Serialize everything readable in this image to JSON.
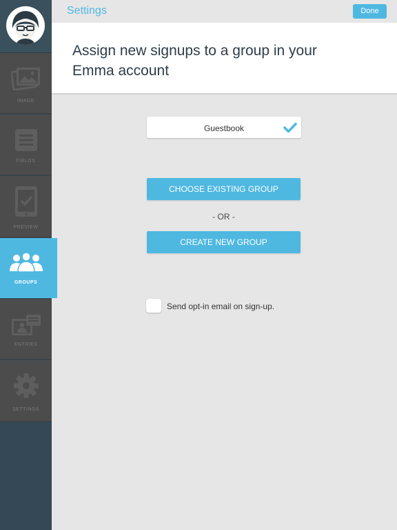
{
  "topbar": {
    "title": "Settings",
    "done_label": "Done"
  },
  "header": {
    "heading": "Assign new signups to a group in your Emma account"
  },
  "sidebar": {
    "items": [
      {
        "label": "IMAGE",
        "icon": "image-icon"
      },
      {
        "label": "FIELDS",
        "icon": "fields-icon"
      },
      {
        "label": "PREVIEW",
        "icon": "preview-icon"
      },
      {
        "label": "GROUPS",
        "icon": "groups-icon",
        "active": true
      },
      {
        "label": "ENTRIES",
        "icon": "entries-icon"
      },
      {
        "label": "SETTINGS",
        "icon": "gear-icon"
      }
    ]
  },
  "group": {
    "selected": "Guestbook"
  },
  "actions": {
    "choose_label": "CHOOSE EXISTING GROUP",
    "or_label": "- OR -",
    "create_label": "CREATE NEW GROUP"
  },
  "optin": {
    "label": "Send opt-in email on sign-up.",
    "checked": false
  },
  "colors": {
    "accent": "#4fb8e1",
    "sidebar": "#344955",
    "nav_bg": "#4c4c4c"
  }
}
